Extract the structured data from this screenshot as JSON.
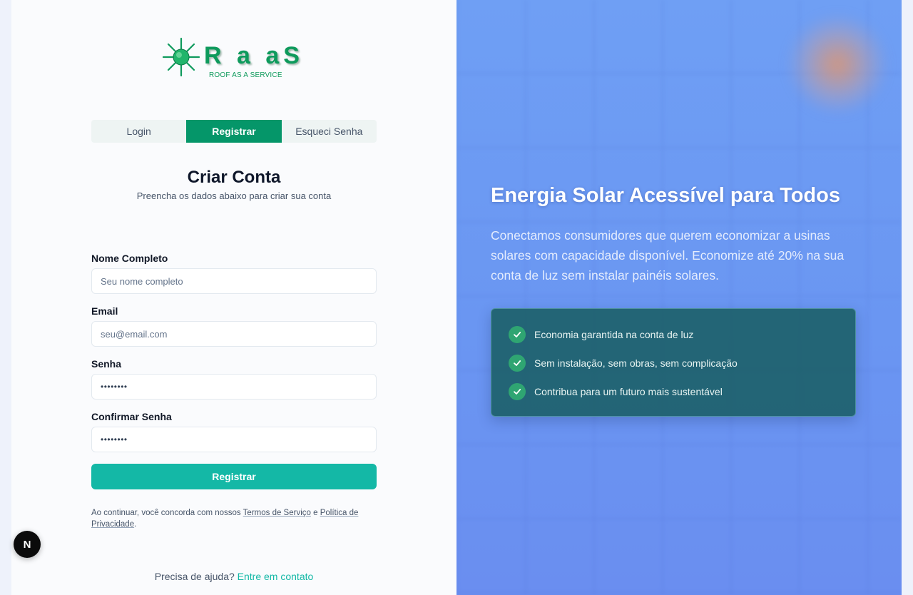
{
  "logo": {
    "wordmark": "R a aS",
    "tagline": "ROOF AS A SERVICE"
  },
  "tabs": [
    {
      "label": "Login",
      "active": false
    },
    {
      "label": "Registrar",
      "active": true
    },
    {
      "label": "Esqueci Senha",
      "active": false
    }
  ],
  "form": {
    "title": "Criar Conta",
    "subtitle": "Preencha os dados abaixo para criar sua conta",
    "name_label": "Nome Completo",
    "name_placeholder": "Seu nome completo",
    "email_label": "Email",
    "email_placeholder": "seu@email.com",
    "password_label": "Senha",
    "password_value": "••••••••",
    "confirm_label": "Confirmar Senha",
    "confirm_value": "••••••••",
    "submit_label": "Registrar"
  },
  "terms": {
    "prefix": "Ao continuar, você concorda com nossos ",
    "terms_link": "Termos de Serviço",
    "middle": " e ",
    "privacy_link": "Política de Privacidade",
    "suffix": "."
  },
  "help": {
    "text": "Precisa de ajuda? ",
    "link": "Entre em contato"
  },
  "badge": {
    "label": "N"
  },
  "hero": {
    "title": "Energia Solar Acessível para Todos",
    "description": "Conectamos consumidores que querem economizar a usinas solares com capacidade disponível. Economize até 20% na sua conta de luz sem instalar painéis solares.",
    "features": [
      "Economia garantida na conta de luz",
      "Sem instalação, sem obras, sem complicação",
      "Contribua para um futuro mais sustentável"
    ]
  },
  "colors": {
    "brand_green": "#059669",
    "accent_teal": "#14b8a6",
    "hero_blue": "#6f9ff4"
  }
}
